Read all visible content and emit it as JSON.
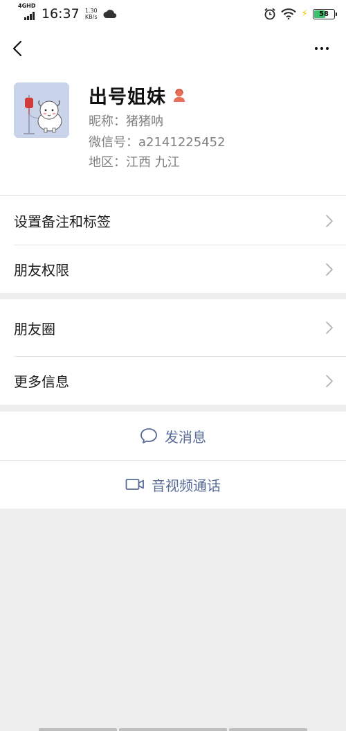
{
  "status_bar": {
    "network": "4GHD",
    "time": "16:37",
    "speed_value": "1.30",
    "speed_unit": "KB/s",
    "battery": "58",
    "battery_percent": 58,
    "battery_color": "#39c26b"
  },
  "nav": {
    "back_icon": "chevron-left-icon",
    "more_icon": "more-dots-icon"
  },
  "profile": {
    "name": "出号姐妹",
    "gender_icon": "female-icon",
    "nickname": "昵称：猪猪呐",
    "wechat_id": "微信号：a2141225452",
    "region": "地区：江西  九江"
  },
  "list_group_1": [
    {
      "label": "设置备注和标签"
    },
    {
      "label": "朋友权限"
    }
  ],
  "list_group_2": [
    {
      "label": "朋友圈"
    },
    {
      "label": "更多信息"
    }
  ],
  "actions": {
    "message_label": "发消息",
    "message_icon": "chat-bubble-icon",
    "call_label": "音视频通话",
    "call_icon": "video-camera-icon",
    "color": "#576b95"
  }
}
